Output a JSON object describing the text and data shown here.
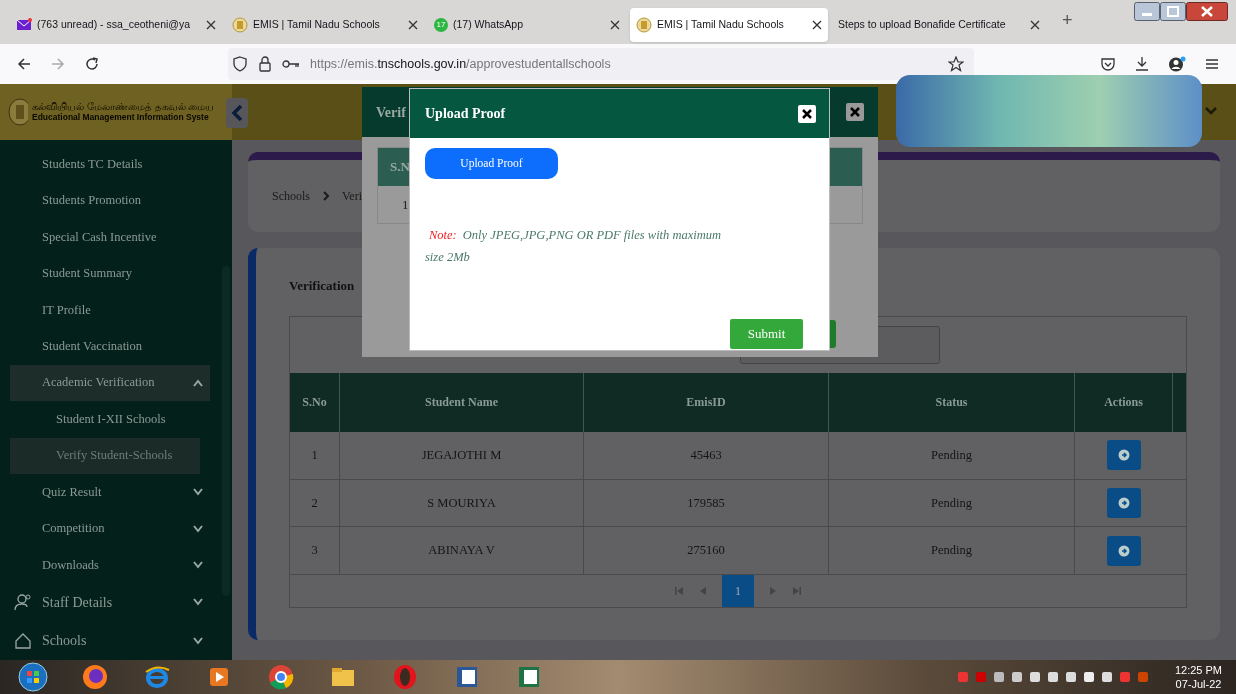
{
  "browser": {
    "tabs": [
      {
        "title": "(763 unread) - ssa_ceotheni@ya",
        "kind": "mail",
        "selected": false
      },
      {
        "title": "EMIS | Tamil Nadu Schools",
        "kind": "emblem",
        "selected": false
      },
      {
        "title": "(17) WhatsApp",
        "kind": "chat",
        "badge": "17",
        "selected": false
      },
      {
        "title": "EMIS | Tamil Nadu Schools",
        "kind": "emblem",
        "selected": true
      },
      {
        "title": "Steps to upload Bonafide Certificate",
        "kind": "plain",
        "selected": false
      }
    ],
    "new_tab": "+",
    "url": {
      "scheme": "https://emis.",
      "domain": "tnschools.gov.in",
      "path": "/approvestudentallschools"
    }
  },
  "header": {
    "title_tamil": "கல்வியியல் மேலாண்மைத் தகவல் மைய",
    "title_english": "Educational Management Information Syste"
  },
  "sidebar": {
    "items": [
      {
        "label": "Students TC Details",
        "kind": "link",
        "selected": false
      },
      {
        "label": "Students Promotion",
        "kind": "link",
        "selected": false
      },
      {
        "label": "Special Cash Incentive",
        "kind": "link",
        "selected": false
      },
      {
        "label": "Student Summary",
        "kind": "link",
        "selected": false
      },
      {
        "label": "IT Profile",
        "kind": "link",
        "selected": false
      },
      {
        "label": "Student Vaccination",
        "kind": "link",
        "selected": false
      },
      {
        "label": "Academic Verification",
        "kind": "group",
        "expanded": true,
        "selected": true,
        "children": [
          {
            "label": "Student I-XII Schools",
            "selected": false
          },
          {
            "label": "Verify Student-Schools",
            "selected": true
          }
        ]
      },
      {
        "label": "Quiz Result",
        "kind": "group",
        "expanded": false,
        "selected": false
      },
      {
        "label": "Competition",
        "kind": "group",
        "expanded": false,
        "selected": false
      },
      {
        "label": "Downloads",
        "kind": "group",
        "expanded": false,
        "selected": false
      },
      {
        "label": "Staff Details",
        "kind": "section",
        "expanded": false,
        "selected": false
      },
      {
        "label": "Schools",
        "kind": "section",
        "expanded": false,
        "selected": false
      }
    ]
  },
  "breadcrumb": [
    "Schools",
    "Veri"
  ],
  "card": {
    "title": "Verification",
    "table": {
      "columns": [
        "S.No",
        "Student Name",
        "EmisID",
        "Status",
        "Actions"
      ],
      "rows": [
        [
          "1",
          "JEGAJOTHI M",
          "45463",
          "Pending"
        ],
        [
          "2",
          "S MOURIYA",
          "179585",
          "Pending"
        ],
        [
          "3",
          "ABINAYA V",
          "275160",
          "Pending"
        ]
      ]
    },
    "pages": [
      {
        "label": "1",
        "selected": true
      }
    ]
  },
  "back_modal": {
    "title": "Verif",
    "column": "S.N",
    "row": "1"
  },
  "modal": {
    "title": "Upload Proof",
    "upload_button": "Upload Proof",
    "note_label": "Note:",
    "note": "Only JPEG,JPG,PNG OR PDF files with maximum size 2Mb",
    "submit": "Submit"
  },
  "taskbar": {
    "time": "12:25 PM",
    "date": "07-Jul-22"
  }
}
